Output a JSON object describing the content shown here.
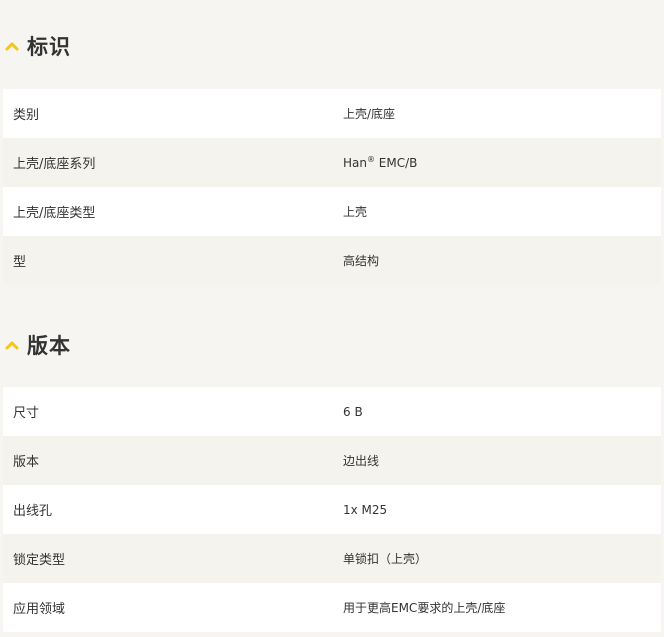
{
  "sections": [
    {
      "title": "标识",
      "rows": [
        {
          "label": "类别",
          "value": "上壳/底座"
        },
        {
          "label": "上壳/底座系列",
          "value_prefix": "Han",
          "value_sup": "®",
          "value_suffix": " EMC/B"
        },
        {
          "label": "上壳/底座类型",
          "value": "上壳"
        },
        {
          "label": "型",
          "value": "高结构"
        }
      ]
    },
    {
      "title": "版本",
      "rows": [
        {
          "label": "尺寸",
          "value": "6 B"
        },
        {
          "label": "版本",
          "value": "边出线"
        },
        {
          "label": "出线孔",
          "value": "1x M25"
        },
        {
          "label": "锁定类型",
          "value": "单锁扣（上壳）"
        },
        {
          "label": "应用领域",
          "value": "用于更高EMC要求的上壳/底座"
        }
      ]
    }
  ],
  "accent_color": "#f5c518"
}
